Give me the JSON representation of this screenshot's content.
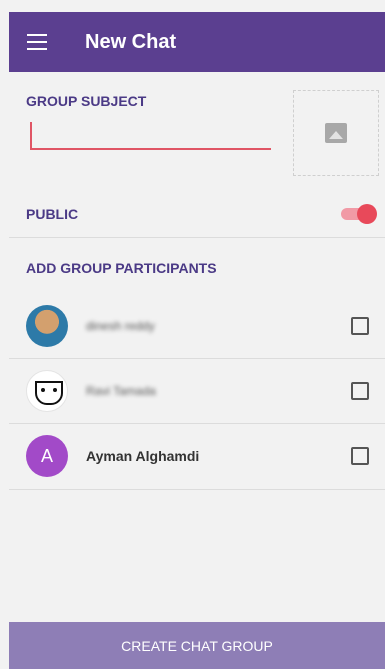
{
  "header": {
    "title": "New Chat",
    "menu_icon": "menu-icon"
  },
  "group_subject": {
    "label": "GROUP SUBJECT",
    "value": "",
    "image_icon": "image-icon"
  },
  "public": {
    "label": "PUBLIC",
    "enabled": true
  },
  "participants": {
    "label": "ADD GROUP PARTICIPANTS",
    "items": [
      {
        "name": "dinesh reddy",
        "avatar": "photo",
        "checked": false
      },
      {
        "name": "Ravi Tamada",
        "avatar": "robot",
        "checked": false
      },
      {
        "name": "Ayman Alghamdi",
        "avatar": "A",
        "checked": false
      }
    ]
  },
  "footer": {
    "create_label": "CREATE CHAT GROUP"
  },
  "colors": {
    "primary": "#5b3f90",
    "accent": "#e8495a",
    "button": "#8e7eb6"
  }
}
